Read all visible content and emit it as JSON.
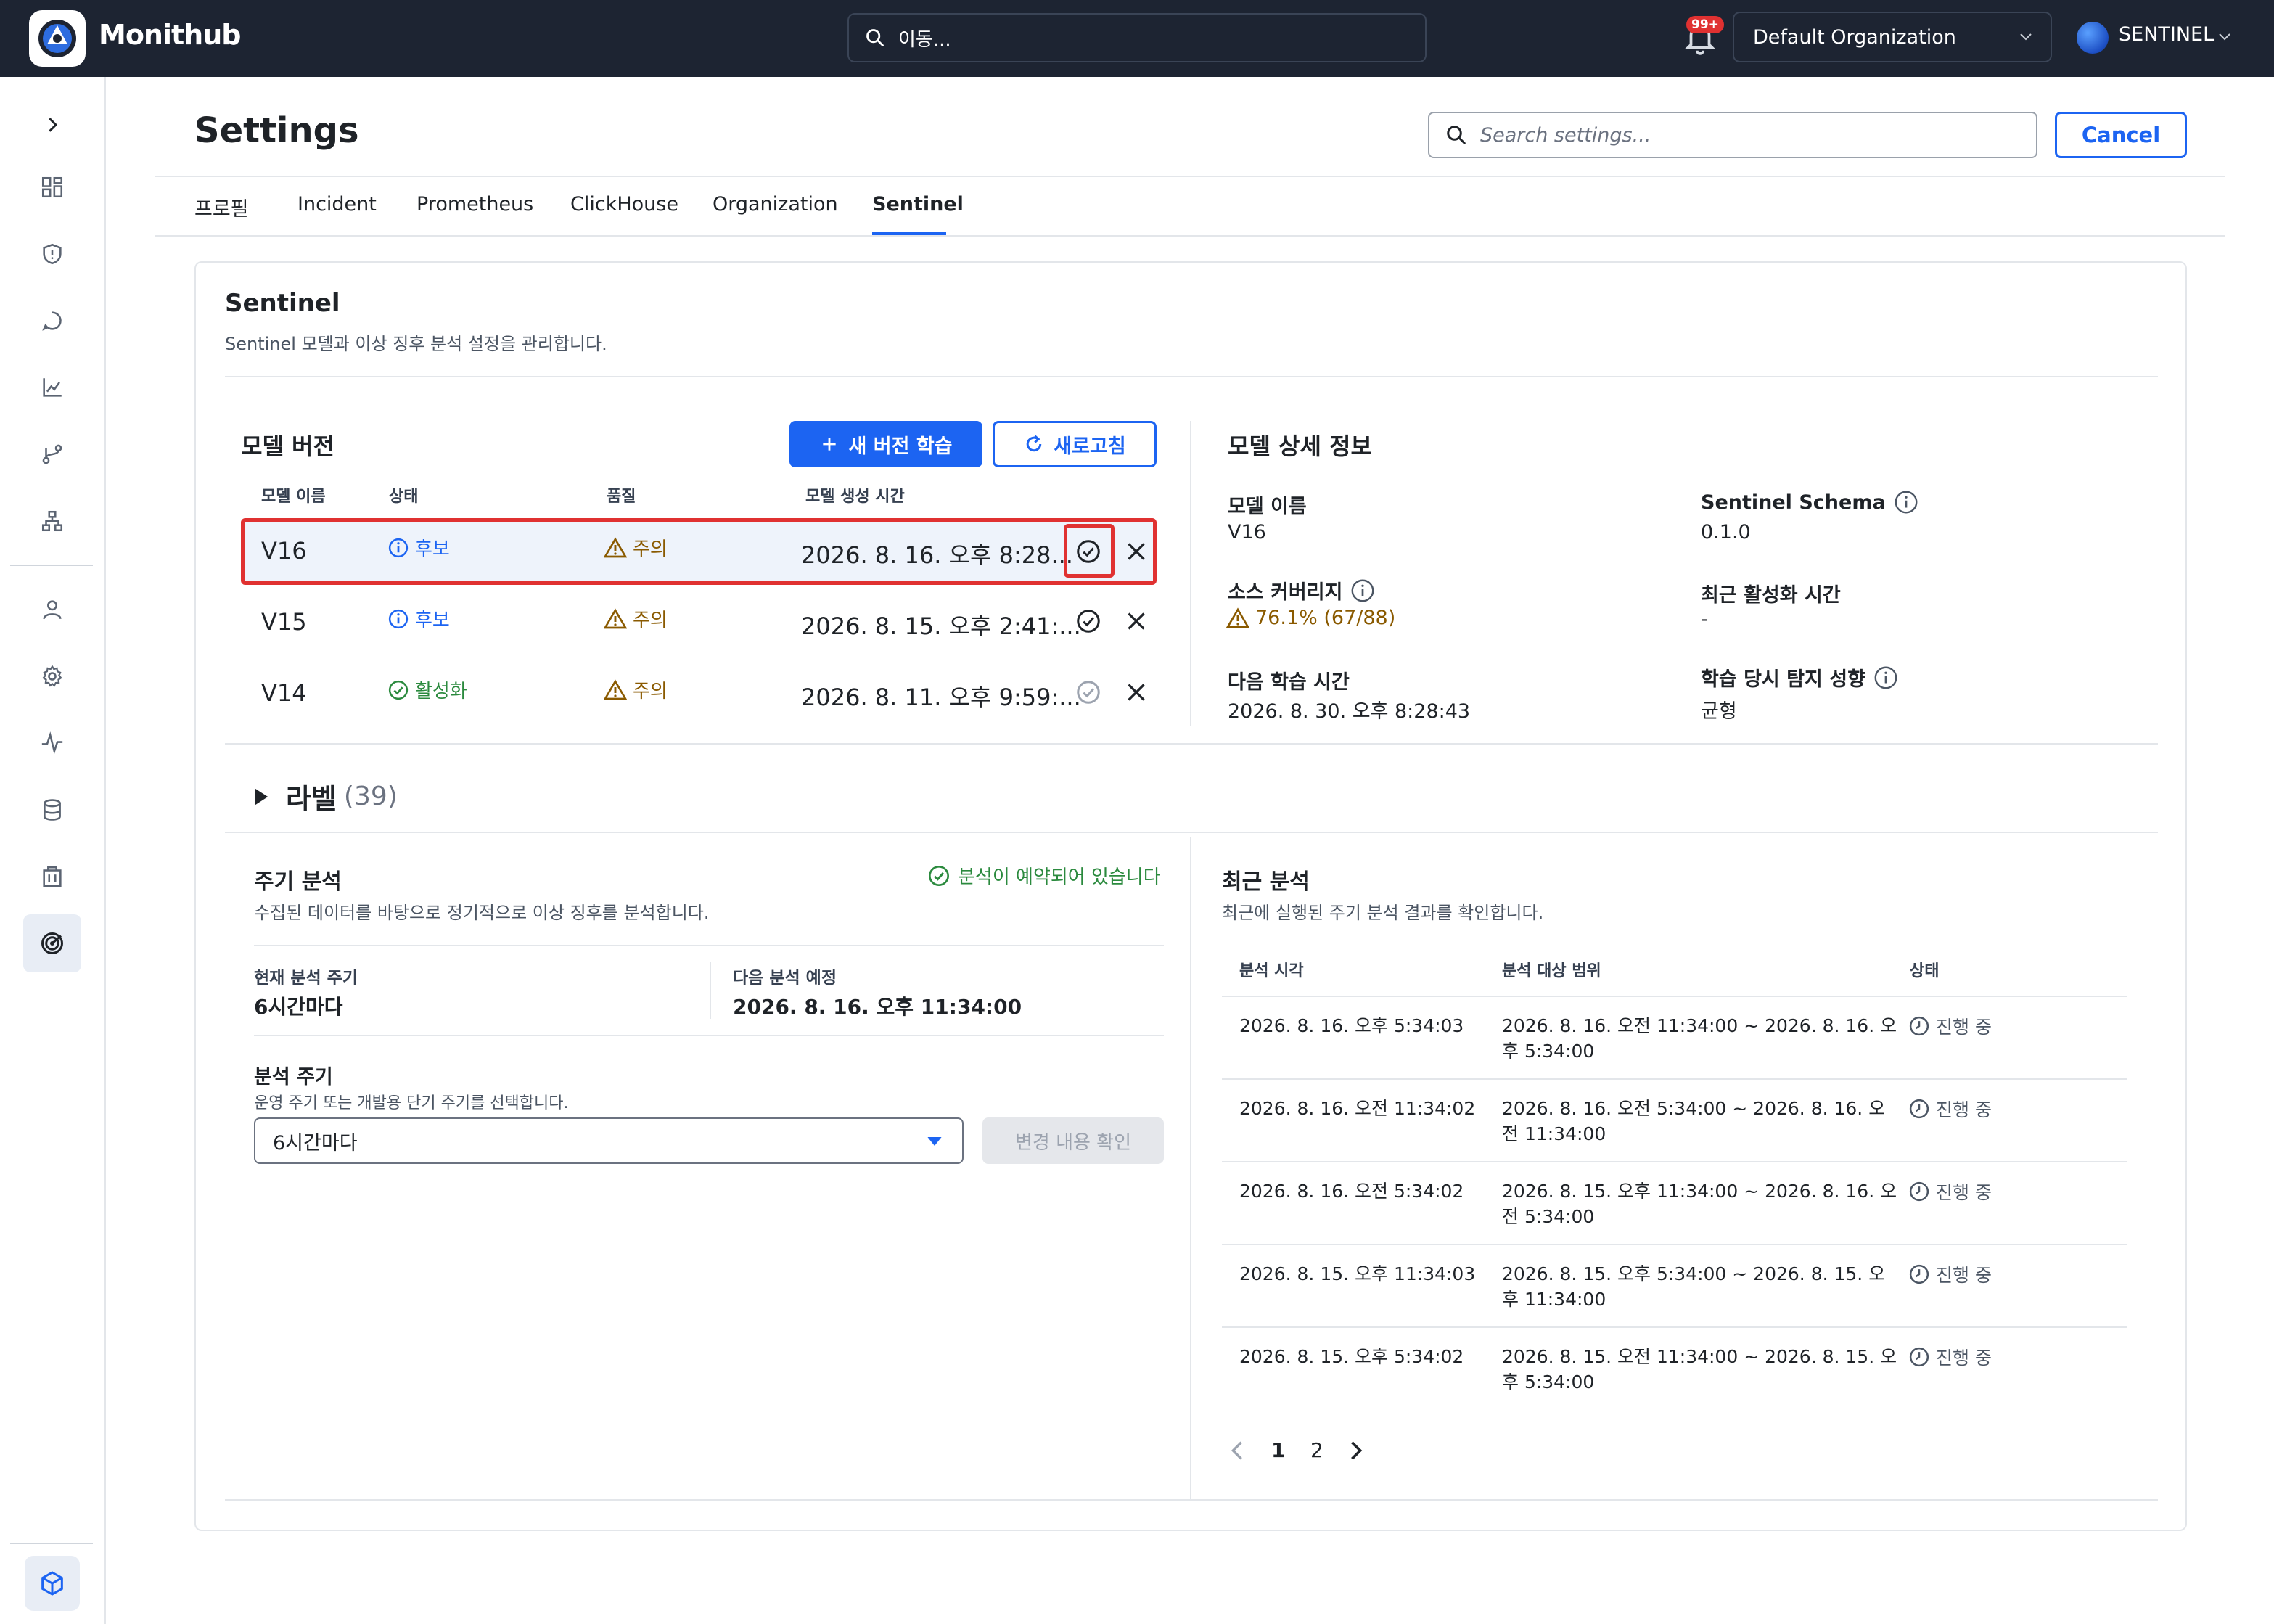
{
  "app": {
    "brand": "Monithub",
    "global_search": "이동...",
    "notifications_badge": "99+",
    "organization": "Default Organization",
    "user": "SENTINEL"
  },
  "page": {
    "title": "Settings",
    "search_placeholder": "Search settings...",
    "cancel_label": "Cancel",
    "tabs": [
      "프로필",
      "Incident",
      "Prometheus",
      "ClickHouse",
      "Organization",
      "Sentinel"
    ],
    "active_tab": "Sentinel"
  },
  "sentinel": {
    "title": "Sentinel",
    "description": "Sentinel 모델과 이상 징후 분석 설정을 관리합니다."
  },
  "model_versions": {
    "title": "모델 버전",
    "train_button": "새 버전 학습",
    "refresh_button": "새로고침",
    "columns": [
      "모델 이름",
      "상태",
      "품질",
      "모델 생성 시간"
    ],
    "rows": [
      {
        "name": "V16",
        "status": "후보",
        "quality": "주의",
        "created": "2026. 8. 16. 오후 8:28..."
      },
      {
        "name": "V15",
        "status": "후보",
        "quality": "주의",
        "created": "2026. 8. 15. 오후 2:41:..."
      },
      {
        "name": "V14",
        "status": "활성화",
        "quality": "주의",
        "created": "2026. 8. 11. 오후 9:59:..."
      }
    ]
  },
  "model_detail": {
    "title": "모델 상세 정보",
    "model_name_label": "모델 이름",
    "model_name_value": "V16",
    "schema_label": "Sentinel Schema",
    "schema_value": "0.1.0",
    "coverage_label": "소스 커버리지",
    "coverage_value": "76.1% (67/88)",
    "last_activation_label": "최근 활성화 시간",
    "last_activation_value": "-",
    "next_training_label": "다음 학습 시간",
    "next_training_value": "2026. 8. 30. 오후 8:28:43",
    "tendency_label": "학습 당시 탐지 성향",
    "tendency_value": "균형"
  },
  "labels": {
    "title": "라벨",
    "count": "(39)"
  },
  "periodic": {
    "title": "주기 분석",
    "description": "수집된 데이터를 바탕으로 정기적으로 이상 징후를 분석합니다.",
    "scheduled_status": "분석이 예약되어 있습니다",
    "current_label": "현재 분석 주기",
    "current_value": "6시간마다",
    "next_label": "다음 분석 예정",
    "next_value": "2026. 8. 16. 오후 11:34:00",
    "interval_title": "분석 주기",
    "interval_desc": "운영 주기 또는 개발용 단기 주기를 선택합니다.",
    "interval_selected": "6시간마다",
    "confirm_button": "변경 내용 확인"
  },
  "recent": {
    "title": "최근 분석",
    "description": "최근에 실행된 주기 분석 결과를 확인합니다.",
    "columns": [
      "분석 시각",
      "분석 대상 범위",
      "상태"
    ],
    "rows": [
      {
        "time": "2026. 8. 16. 오후 5:34:03",
        "range_l1": "2026. 8. 16. 오전 11:34:00 ~ 2026. 8. 16. 오",
        "range_l2": "후 5:34:00",
        "status": "진행 중"
      },
      {
        "time": "2026. 8. 16. 오전 11:34:02",
        "range_l1": "2026. 8. 16. 오전 5:34:00 ~ 2026. 8. 16. 오",
        "range_l2": "전 11:34:00",
        "status": "진행 중"
      },
      {
        "time": "2026. 8. 16. 오전 5:34:02",
        "range_l1": "2026. 8. 15. 오후 11:34:00 ~ 2026. 8. 16. 오",
        "range_l2": "전 5:34:00",
        "status": "진행 중"
      },
      {
        "time": "2026. 8. 15. 오후 11:34:03",
        "range_l1": "2026. 8. 15. 오후 5:34:00 ~ 2026. 8. 15. 오",
        "range_l2": "후 11:34:00",
        "status": "진행 중"
      },
      {
        "time": "2026. 8. 15. 오후 5:34:02",
        "range_l1": "2026. 8. 15. 오전 11:34:00 ~ 2026. 8. 15. 오",
        "range_l2": "후 5:34:00",
        "status": "진행 중"
      }
    ],
    "pages": [
      "1",
      "2"
    ],
    "current_page": "1"
  },
  "colors": {
    "topbar": "#1d2432",
    "accent": "#1c64f2",
    "success": "#2b8a3e",
    "warning": "#8a5a00",
    "highlight": "#e03131"
  },
  "icons": [
    "search-icon",
    "bell-icon",
    "chevron-down-icon",
    "plus-icon",
    "refresh-icon",
    "info-icon",
    "warning-icon",
    "check-circle-icon",
    "close-icon",
    "clock-icon",
    "caret-down-icon",
    "chevron-left-icon",
    "chevron-right-icon",
    "triangle-right-icon"
  ]
}
